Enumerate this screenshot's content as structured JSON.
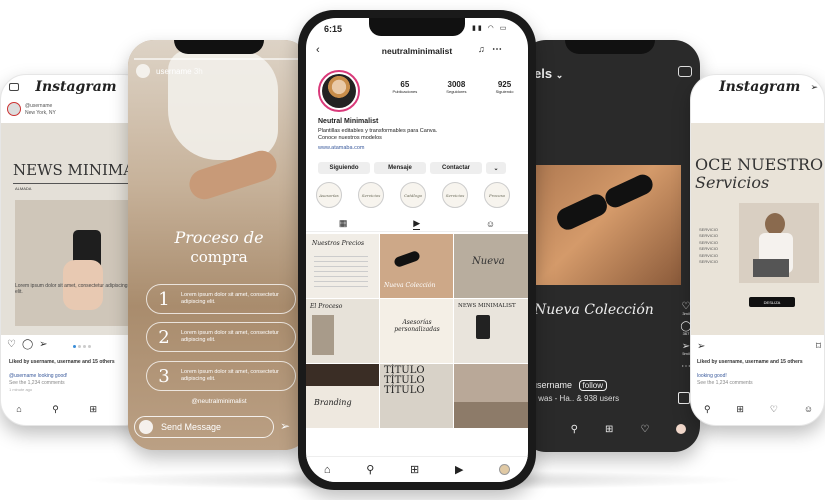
{
  "far_left": {
    "brand": "Instagram",
    "account": "@username",
    "location": "New York, NY",
    "post_title": "NEWS MINIMA",
    "post_label": "ALMADA",
    "post_body": "Lorem ipsum dolor sit amet, consectetur adipiscing elit.",
    "likes_text": "Liked by username, username and 15 others",
    "caption": "@username looking good!",
    "comments": "See the 1,234 comments",
    "time": "1 minute ago"
  },
  "left_story": {
    "username": "username",
    "time": "3h",
    "title_line1": "Proceso de",
    "title_line2": "compra",
    "steps": [
      {
        "num": "1",
        "text": "Lorem ipsum dolor sit amet, consectetur adipiscing elit."
      },
      {
        "num": "2",
        "text": "Lorem ipsum dolor sit amet, consectetur adipiscing elit."
      },
      {
        "num": "3",
        "text": "Lorem ipsum dolor sit amet, consectetur adipiscing elit."
      }
    ],
    "handle": "@neutralminimalist",
    "send_placeholder": "Send Message"
  },
  "center": {
    "status_time": "6:15",
    "profile_username": "neutralminimalist",
    "stats": [
      {
        "value": "65",
        "label": "Publicaciones"
      },
      {
        "value": "3008",
        "label": "Seguidores"
      },
      {
        "value": "925",
        "label": "Siguiendo"
      }
    ],
    "display_name": "Neutral Minimalist",
    "bio_line1": "Plantillas editables y transformables para Canva.",
    "bio_line2": "Conoce nuestros modelos",
    "link": "www.atamaba.com",
    "buttons": {
      "follow": "Siguiendo",
      "message": "Mensaje",
      "contact": "Contactar"
    },
    "highlights": [
      "Asesorías",
      "Servicios",
      "Catálogo",
      "Servicios",
      "Proceso"
    ],
    "grid_texts": {
      "c1": "Nuestros Precios",
      "c2": "Nueva Colección",
      "c3": "Nueva",
      "c4": "El Proceso",
      "c5": "Asesorías personalizadas",
      "c6": "NEWS MINIMALIST",
      "c7": "Branding",
      "c8": "TÍTULO TÍTULO TÍTULO",
      "c9": ""
    }
  },
  "right_reels": {
    "header": "els",
    "collection": "Nueva Colección",
    "side_counts": [
      "3mil",
      "367",
      "5mil"
    ],
    "username": "username",
    "follow": "follow",
    "caption": "it was - Ha.. & 938 users"
  },
  "far_right": {
    "brand": "Instagram",
    "title_line1": "OCE NUESTROS",
    "title_line2": "Servicios",
    "services": [
      "SERVICIO",
      "SERVICIO",
      "SERVICIO",
      "SERVICIO",
      "SERVICIO",
      "SERVICIO"
    ],
    "cta": "DESLIZA",
    "likes_text": "Liked by username, username and 15 others",
    "caption": "looking good!",
    "comments": "See the 1,234 comments"
  },
  "colors": {
    "accent_link": "#3a5a9c",
    "beige": "#e9e3d8",
    "dark": "#2a2a2a"
  }
}
